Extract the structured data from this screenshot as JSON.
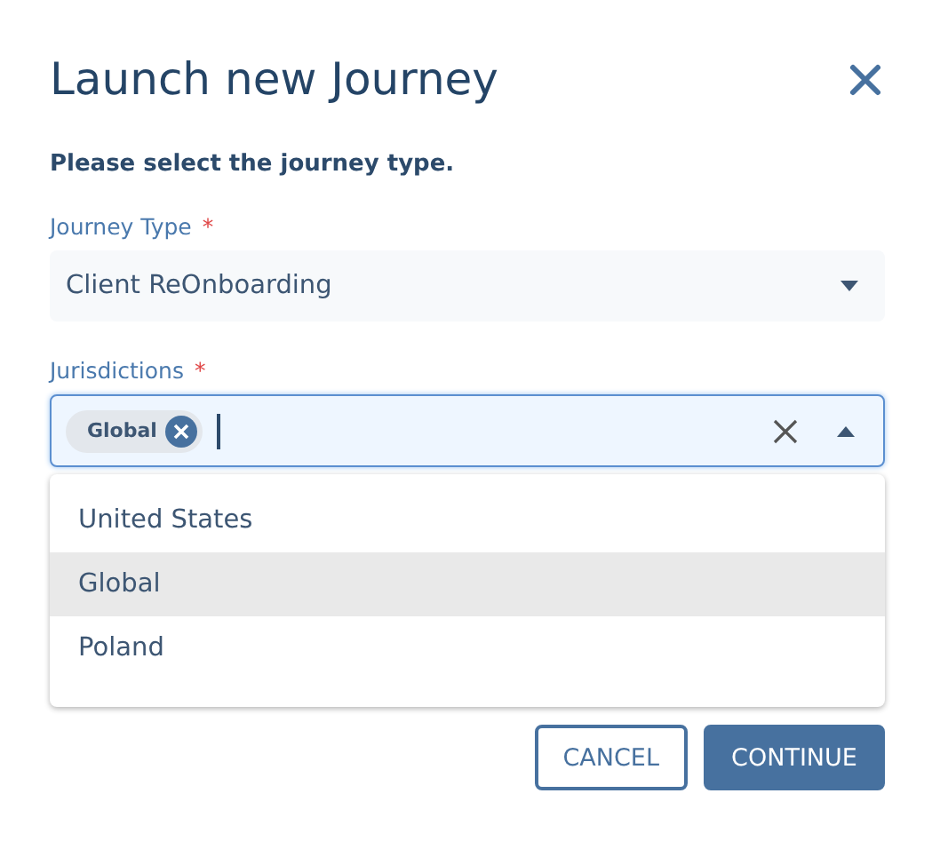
{
  "dialog": {
    "title": "Launch new Journey",
    "instruction": "Please select the journey type."
  },
  "journey_type": {
    "label": "Journey Type",
    "required_mark": "*",
    "value": "Client ReOnboarding"
  },
  "jurisdictions": {
    "label": "Jurisdictions",
    "required_mark": "*",
    "focused": true,
    "expanded": true,
    "chips": [
      {
        "label": "Global"
      }
    ],
    "options": [
      {
        "label": "United States",
        "selected": false
      },
      {
        "label": "Global",
        "selected": true
      },
      {
        "label": "Poland",
        "selected": false
      }
    ]
  },
  "buttons": [
    {
      "label": "CANCEL",
      "kind": "outline"
    },
    {
      "label": "CONTINUE",
      "kind": "primary"
    }
  ]
}
